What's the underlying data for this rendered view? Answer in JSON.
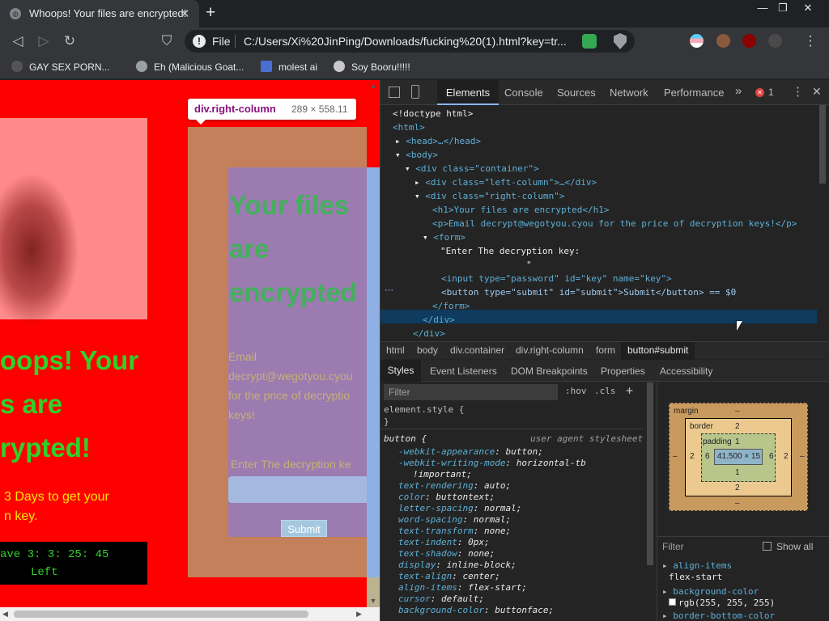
{
  "browser": {
    "tab_title": "Whoops! Your files are encrypted!",
    "tab_close": "✕",
    "new_tab": "+",
    "window_controls": [
      "—",
      "❐",
      "✕"
    ],
    "nav": {
      "back": "◁",
      "forward": "▷",
      "reload": "↻",
      "bookmark": "⛉"
    },
    "omnibox": {
      "scheme_label": "File",
      "url": "C:/Users/Xi%20JinPing/Downloads/fucking%20(1).html?key=tr..."
    },
    "bookmarks": [
      {
        "label": "GAY SEX PORN...",
        "icon": "dark-figure-icon",
        "color": "#444"
      },
      {
        "label": "Eh (Malicious Goat...",
        "icon": "globe-icon",
        "color": "#9aa0a6"
      },
      {
        "label": "molest ai",
        "icon": "image-icon",
        "color": "#4a6fd1"
      },
      {
        "label": "Soy Booru!!!!!",
        "icon": "character-icon",
        "color": "#c9c9c9"
      }
    ]
  },
  "page": {
    "left_column": {
      "heading_lines": [
        "oops! Your",
        "s are",
        "rypted!"
      ],
      "days_lines": [
        " 3 Days to get your",
        "n key."
      ],
      "timer_line1": "ave 3: 3: 25: 45",
      "timer_line2": "Left",
      "colors": {
        "background": "#ff0000",
        "heading": "#2fd12a",
        "days": "#ffe600"
      }
    },
    "right_column": {
      "h1_lines": [
        "Your files",
        "are",
        "encrypted"
      ],
      "p_lines": [
        "Email",
        "decrypt@wegotyou.cyou",
        "for the price of decryptio",
        "keys!"
      ],
      "label": "Enter The decryption ke",
      "submit": "Submit"
    },
    "tooltip": {
      "tag": "div.right-column",
      "dims": "289 × 558.11"
    }
  },
  "devtools": {
    "tabs": [
      "Console",
      "Sources",
      "Network",
      "Performance"
    ],
    "active_tab": "Elements",
    "overflow": "»",
    "error_count": "1",
    "dom_lines": [
      "<!doctype html>",
      "<html>",
      "<head>…</head>",
      "<body>",
      "<div class=\"container\">",
      "<div class=\"left-column\">…</div>",
      "<div class=\"right-column\">",
      "<h1>Your files are encrypted</h1>",
      "<p>Email decrypt@wegotyou.cyou for the price of decryption keys!</p>",
      "<form>",
      "\"Enter The decryption key:",
      "\"",
      "<input type=\"password\" id=\"key\" name=\"key\">",
      "<button type=\"submit\" id=\"submit\">Submit</button> == $0",
      "</form>",
      "</div>",
      "</div>"
    ],
    "breadcrumbs": [
      "html",
      "body",
      "div.container",
      "div.right-column",
      "form",
      "button#submit"
    ],
    "panel_tabs": [
      "Styles",
      "Event Listeners",
      "DOM Breakpoints",
      "Properties",
      "Accessibility"
    ],
    "styles": {
      "filter_placeholder": "Filter",
      "hov": ":hov",
      "cls": ".cls",
      "plus": "+",
      "element_style": "element.style {",
      "close_brace": "}",
      "selector": "button {",
      "origin": "user agent stylesheet",
      "props": [
        [
          "-webkit-appearance",
          "button;"
        ],
        [
          "-webkit-writing-mode",
          "horizontal-tb"
        ],
        [
          "",
          "!important;"
        ],
        [
          "text-rendering",
          "auto;"
        ],
        [
          "color",
          "buttontext;"
        ],
        [
          "letter-spacing",
          "normal;"
        ],
        [
          "word-spacing",
          "normal;"
        ],
        [
          "text-transform",
          "none;"
        ],
        [
          "text-indent",
          "0px;"
        ],
        [
          "text-shadow",
          "none;"
        ],
        [
          "display",
          "inline-block;"
        ],
        [
          "text-align",
          "center;"
        ],
        [
          "align-items",
          "flex-start;"
        ],
        [
          "cursor",
          "default;"
        ],
        [
          "background-color",
          "buttonface;"
        ]
      ]
    },
    "box_model": {
      "margin_label": "margin",
      "margin": "–",
      "margin_sides": [
        "–",
        "–"
      ],
      "border_label": "border",
      "border": "2",
      "padding_label": "padding",
      "padding": "1",
      "content": "41.500 × 15",
      "side_left": "6",
      "side_right": "6",
      "outer_left": "2",
      "outer_right": "2",
      "padding_bottom": "1",
      "border_bottom": "2",
      "margin_bottom": "–"
    },
    "computed": {
      "filter_placeholder": "Filter",
      "show_all": "Show all",
      "items": [
        {
          "name": "align-items",
          "value": "flex-start"
        },
        {
          "name": "background-color",
          "value": "rgb(255, 255, 255)"
        },
        {
          "name": "border-bottom-color",
          "value": ""
        }
      ]
    }
  }
}
